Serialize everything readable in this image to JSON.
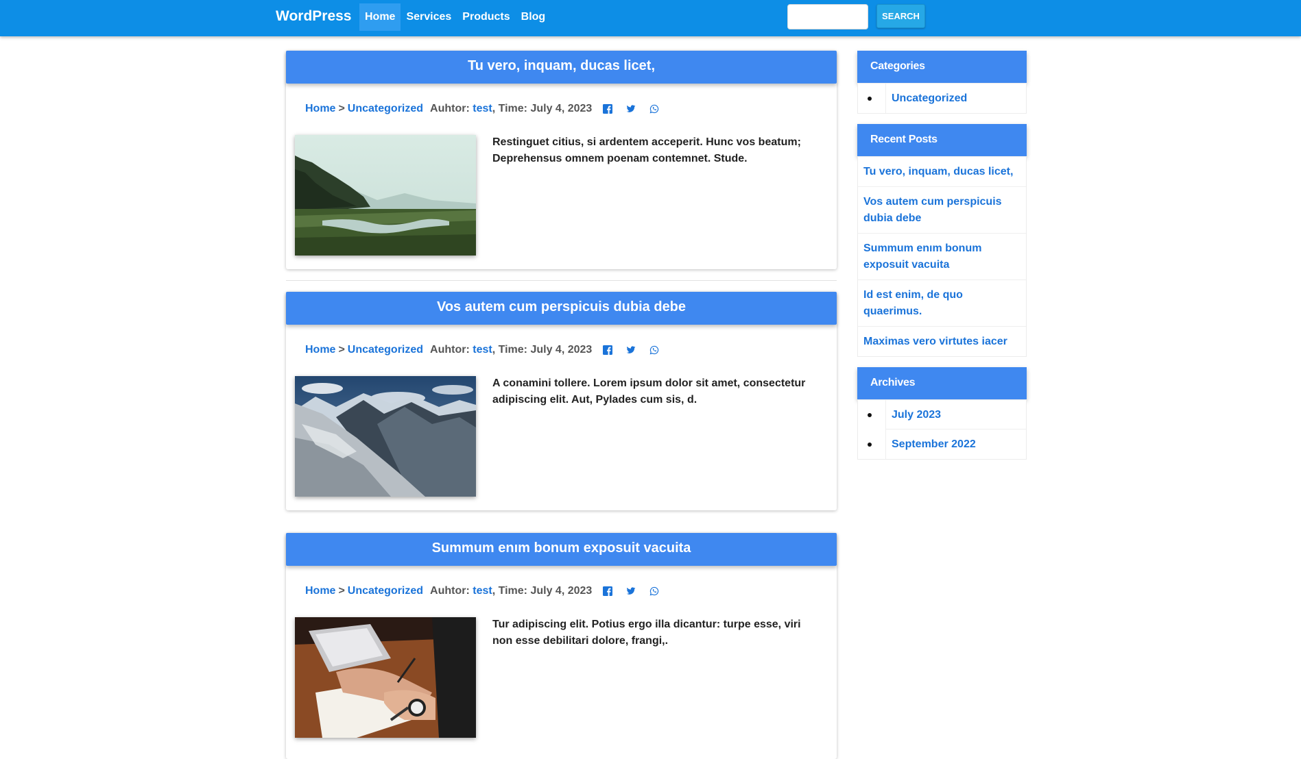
{
  "navbar": {
    "brand": "WordPress",
    "links": [
      "Home",
      "Services",
      "Products",
      "Blog"
    ],
    "active": "Home",
    "search_placeholder": "",
    "search_button": "SEARCH",
    "color": "#0d8ee6"
  },
  "meta_labels": {
    "home": "Home",
    "sep": ">",
    "author_label": "Auhtor:",
    "time_label": "Time:"
  },
  "posts": [
    {
      "title": "Tu vero, inquam, ducas licet,",
      "category": "Uncategorized",
      "author": "test",
      "date": "July 4, 2023",
      "excerpt": "Restinguet citius, si ardentem acceperit. Hunc vos beatum; Deprehensus omnem poenam contemnet. Stude.",
      "image": "misty-valley-lake"
    },
    {
      "title": "Vos autem cum perspicuis dubia debe",
      "category": "Uncategorized",
      "author": "test",
      "date": "July 4, 2023",
      "excerpt": "A conamini tollere. Lorem ipsum dolor sit amet, consectetur adipiscing elit. Aut, Pylades cum sis, d.",
      "image": "snowy-mountains"
    },
    {
      "title": "Summum enım bonum exposuit vacuita",
      "category": "Uncategorized",
      "author": "test",
      "date": "July 4, 2023",
      "excerpt": "Tur adipiscing elit. Potius ergo illa dicantur: turpe esse, viri non esse debilitari dolore, frangi,.",
      "image": "hands-writing-notebook"
    }
  ],
  "share_icons": [
    "facebook-icon",
    "twitter-icon",
    "whatsapp-icon"
  ],
  "sidebar": {
    "categories": {
      "title": "Categories",
      "items": [
        "Uncategorized"
      ]
    },
    "recent": {
      "title": "Recent Posts",
      "items": [
        "Tu vero, inquam, ducas licet,",
        "Vos autem cum perspicuis dubia debe",
        "Summum enım bonum exposuit vacuita",
        "Id est enim, de quo quaerimus.",
        "Maximas vero virtutes iacer"
      ]
    },
    "archives": {
      "title": "Archives",
      "items": [
        "July 2023",
        "September 2022"
      ]
    }
  },
  "colors": {
    "header_blue": "#3f88f0",
    "link_blue": "#1a73d9"
  }
}
